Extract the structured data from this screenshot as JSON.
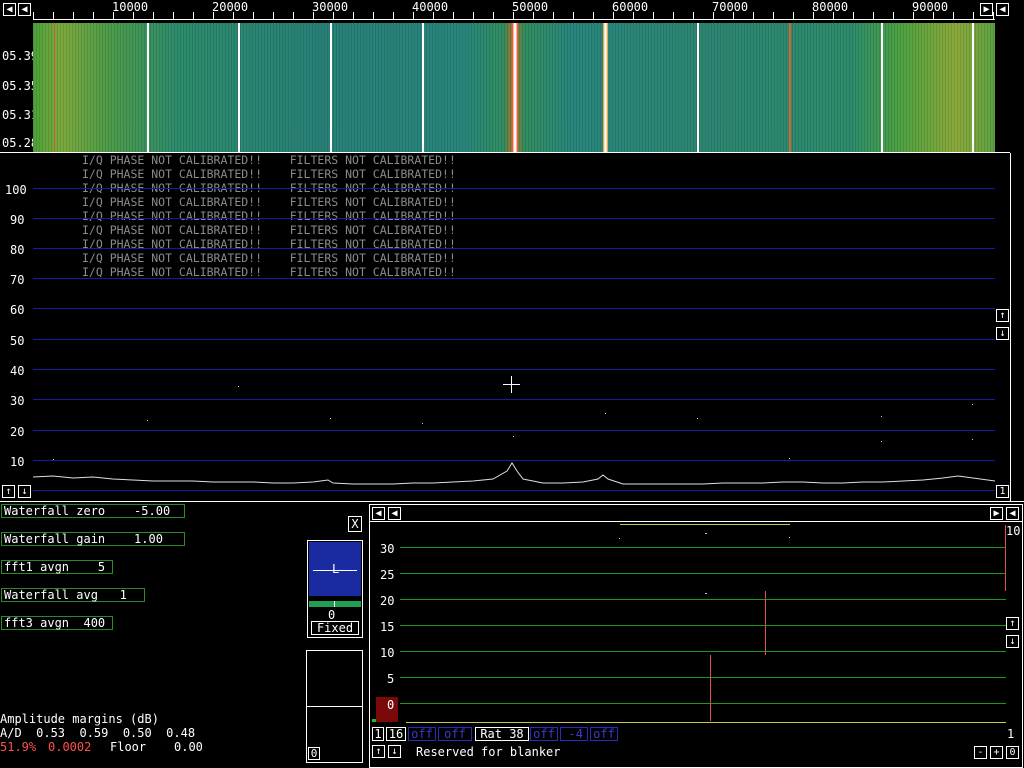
{
  "waterfall": {
    "freq_ticks": [
      "10000",
      "20000",
      "30000",
      "40000",
      "50000",
      "60000",
      "70000",
      "80000",
      "90000"
    ],
    "time_labels": [
      "05.39",
      "05.35",
      "05.31",
      "05.28"
    ]
  },
  "spectrum": {
    "y_ticks": [
      "100",
      "90",
      "80",
      "70",
      "60",
      "50",
      "40",
      "30",
      "20",
      "10"
    ],
    "warning_line": "I/Q PHASE NOT CALIBRATED!!    FILTERS NOT CALIBRATED!!",
    "corner_label": "1"
  },
  "controls": {
    "waterfall_zero": "Waterfall zero    -5.00",
    "waterfall_gain": "Waterfall gain    1.00",
    "fft1_avgn": "fft1 avgn    5",
    "waterfall_avg": "Waterfall avg   1",
    "fft3_avgn": "fft3 avgn  400",
    "close_label": "X"
  },
  "level_widget": {
    "marker": "L",
    "value": "0",
    "mode": "Fixed",
    "small_value": "0"
  },
  "amplitude": {
    "title": "Amplitude margins (dB)",
    "ad_line": "A/D  0.53  0.59  0.50  0.48",
    "percent": "51.9%",
    "ratio": "0.0002",
    "floor_label": "Floor",
    "floor_value": "0.00"
  },
  "baseband": {
    "y_ticks": [
      "30",
      "25",
      "20",
      "15",
      "10",
      "5",
      "0"
    ],
    "top_right_label": "10",
    "bottom_right_label": "1",
    "bottom_buttons": [
      "1",
      "16",
      "off",
      "off",
      "Rat 38",
      "off",
      "-4",
      "off"
    ],
    "blanker_text": "Reserved for blanker",
    "minus_label": "-",
    "plus_label": "+",
    "zero_label": "0"
  },
  "colors": {
    "grid_blue": "#1a1aa0",
    "grid_green": "#1a9a1a",
    "panel_border": "#2a8a2a"
  }
}
